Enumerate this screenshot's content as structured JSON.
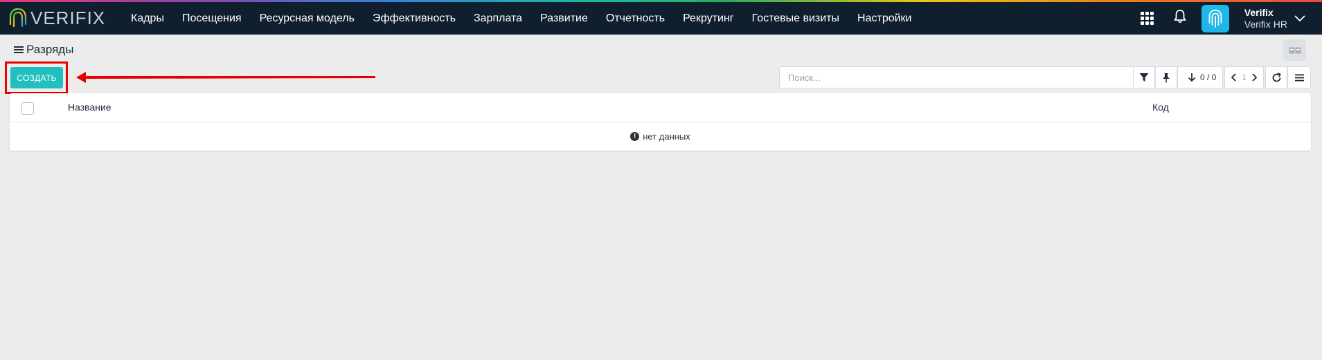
{
  "app": {
    "logo_text": "VERIFIX",
    "menu": [
      "Кадры",
      "Посещения",
      "Ресурсная модель",
      "Эффективность",
      "Зарплата",
      "Развитие",
      "Отчетность",
      "Рекрутинг",
      "Гостевые визиты",
      "Настройки"
    ],
    "user": {
      "name": "Verifix",
      "company": "Verifix HR"
    }
  },
  "page": {
    "title": "Разряды",
    "create_label": "СОЗДАТЬ",
    "search_placeholder": "Поиск...",
    "pager_count": "0 / 0",
    "page_number": "1"
  },
  "table": {
    "columns": [
      "Название",
      "Код"
    ],
    "empty_text": "нет данных"
  },
  "colors": {
    "navbar": "#0f1f2e",
    "accent": "#21bfbf",
    "highlight": "#e60000"
  }
}
